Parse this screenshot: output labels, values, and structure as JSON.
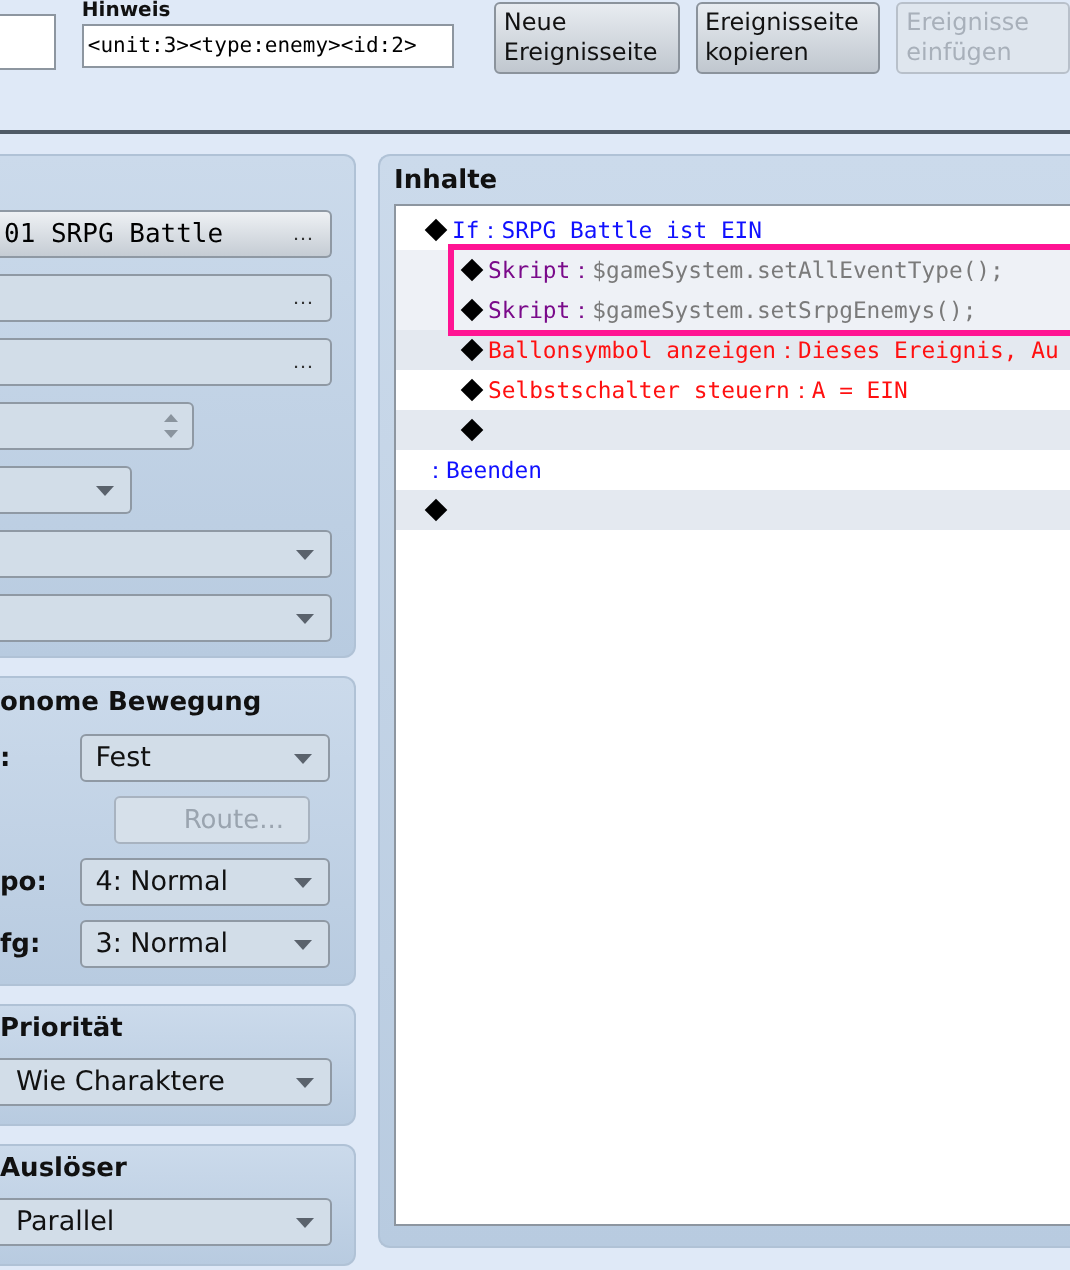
{
  "top_bar": {
    "note": {
      "label": "Hinweis",
      "value": "<unit:3><type:enemy><id:2>"
    },
    "buttons": [
      {
        "label": "Neue Ereignisseite",
        "disabled": false
      },
      {
        "label": "Ereignisseite kopieren",
        "disabled": false
      },
      {
        "label": "Ereignisse einfügen",
        "disabled": true
      }
    ]
  },
  "conditions": {
    "fields": [
      {
        "kind": "picker",
        "value": "01 SRPG Battle",
        "icon": "…"
      },
      {
        "kind": "picker",
        "icon": "…"
      },
      {
        "kind": "picker",
        "icon": "…"
      },
      {
        "kind": "spin"
      },
      {
        "kind": "short-dropdown"
      },
      {
        "kind": "dropdown"
      },
      {
        "kind": "dropdown"
      }
    ]
  },
  "movement": {
    "title": "onome Bewegung",
    "rows": [
      {
        "kind": "dropdown",
        "label": ":",
        "value": "Fest",
        "disabled": false
      },
      {
        "kind": "button",
        "label": "",
        "value": "Route...",
        "disabled": true
      },
      {
        "kind": "dropdown",
        "label": "po:",
        "value": "4: Normal",
        "disabled": false
      },
      {
        "kind": "dropdown",
        "label": "fg:",
        "value": "3: Normal",
        "disabled": false
      }
    ]
  },
  "priority": {
    "title": "Priorität",
    "value": "Wie Charaktere"
  },
  "trigger": {
    "title": "Auslöser",
    "value": "Parallel"
  },
  "contents": {
    "title": "Inhalte",
    "rows": [
      {
        "kind": "condition",
        "label": "If",
        "sep": "：",
        "value": "SRPG Battle ist EIN",
        "highlighted": false,
        "children": [
          {
            "kind": "script",
            "label": "Skript",
            "sep": "：",
            "value": "$gameSystem.setAllEventType();",
            "highlighted": true
          },
          {
            "kind": "script",
            "label": "Skript",
            "sep": "：",
            "value": "$gameSystem.setSrpgEnemys();",
            "highlighted": true
          },
          {
            "kind": "command",
            "label": "Ballonsymbol anzeigen",
            "sep": "：",
            "value": "Dieses Ereignis, Au",
            "highlighted": false
          },
          {
            "kind": "command",
            "label": "Selbstschalter steuern",
            "sep": "：",
            "value": "A = EIN",
            "highlighted": false
          },
          {
            "kind": "empty",
            "highlighted": false
          }
        ]
      },
      {
        "kind": "end",
        "sep": "：",
        "label": "Beenden",
        "highlighted": false
      },
      {
        "kind": "empty",
        "highlighted": false
      }
    ]
  }
}
